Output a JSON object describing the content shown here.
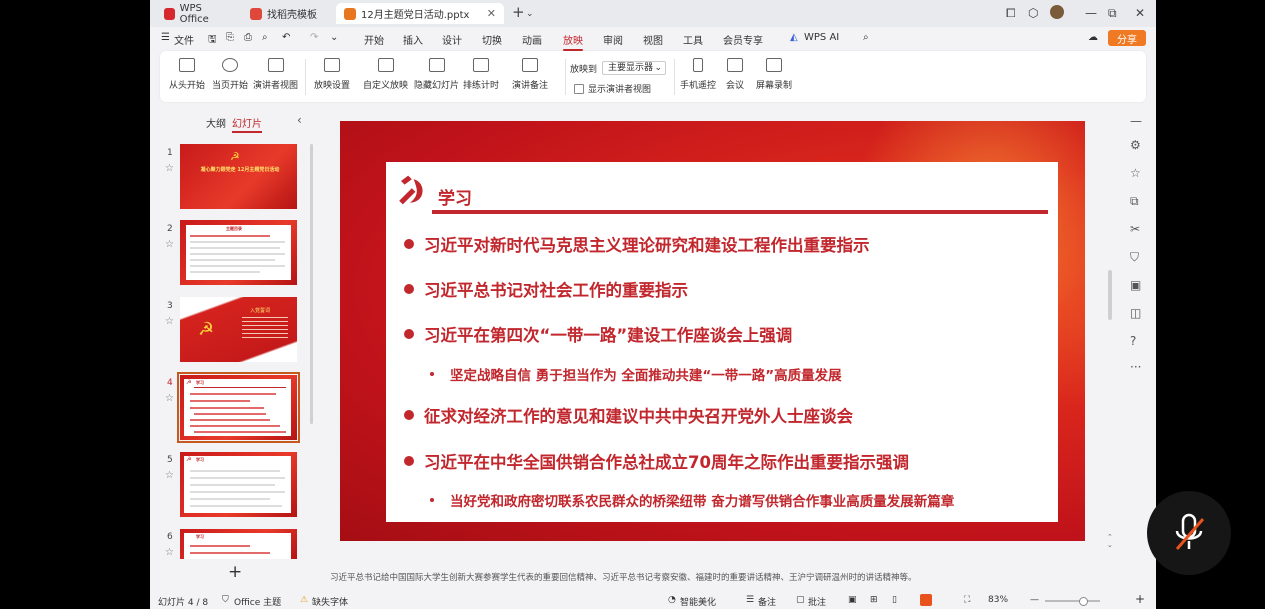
{
  "tabs": [
    {
      "label": "WPS Office",
      "icon": "wps-logo-icon",
      "color": "#d7272e"
    },
    {
      "label": "找稻壳模板",
      "icon": "docer-icon",
      "color": "#e0473b"
    },
    {
      "label": "12月主题党日活动.pptx",
      "icon": "pptx-file-icon",
      "color": "#e8761f"
    }
  ],
  "window_controls": {
    "minimize": "—",
    "maximize": "⧉",
    "close": "✕"
  },
  "menu": {
    "file": "文件",
    "items": [
      "开始",
      "插入",
      "设计",
      "切换",
      "动画",
      "放映",
      "审阅",
      "视图",
      "工具",
      "会员专享"
    ],
    "active": "放映",
    "ai": "WPS AI",
    "share": "分享"
  },
  "ribbon": {
    "buttons": [
      "从头开始",
      "当页开始",
      "演讲者视图",
      "放映设置",
      "自定义放映",
      "隐藏幻灯片",
      "排练计时",
      "演讲备注",
      "手机遥控",
      "会议",
      "屏幕录制"
    ],
    "play_to_label": "放映到",
    "play_to_value": "主要显示器",
    "presenter_checkbox": "显示演讲者视图"
  },
  "panel": {
    "outline_tab": "大纲",
    "slides_tab": "幻灯片",
    "add": "+"
  },
  "thumbnails": [
    {
      "num": "1",
      "title": "凝心聚力跟党走 12月主题党日活动"
    },
    {
      "num": "2",
      "title": "主题目录"
    },
    {
      "num": "3",
      "title": "入党誓词"
    },
    {
      "num": "4",
      "title": "学习"
    },
    {
      "num": "5",
      "title": "学习"
    },
    {
      "num": "6",
      "title": "学习"
    }
  ],
  "current_slide": "4",
  "slide": {
    "title": "学习",
    "bullets": [
      {
        "level": 1,
        "text": "习近平对新时代马克思主义理论研究和建设工程作出重要指示"
      },
      {
        "level": 1,
        "text": "习近平总书记对社会工作的重要指示"
      },
      {
        "level": 1,
        "text": "习近平在第四次“一带一路”建设工作座谈会上强调"
      },
      {
        "level": 2,
        "text": "坚定战略自信 勇于担当作为 全面推动共建“一带一路”高质量发展"
      },
      {
        "level": 1,
        "text": "征求对经济工作的意见和建议中共中央召开党外人士座谈会"
      },
      {
        "level": 1,
        "text": "习近平在中华全国供销合作总社成立70周年之际作出重要指示强调"
      },
      {
        "level": 2,
        "text": "当好党和政府密切联系农民群众的桥梁纽带 奋力谱写供销合作事业高质量发展新篇章"
      }
    ]
  },
  "notes": "习近平总书记给中国国际大学生创新大赛参赛学生代表的重要回信精神、习近平总书记考察安徽、福建时的重要讲话精神、王沪宁调研温州时的讲话精神等。",
  "status": {
    "slide_counter": "幻灯片 4 / 8",
    "theme": "Office 主题",
    "missing_font": "缺失字体",
    "beautify": "智能美化",
    "notes_btn": "备注",
    "comments_btn": "批注",
    "zoom": "83%"
  },
  "colors": {
    "accent": "#c1272d",
    "share": "#f07a24",
    "slide_bg": "#d9261c"
  }
}
